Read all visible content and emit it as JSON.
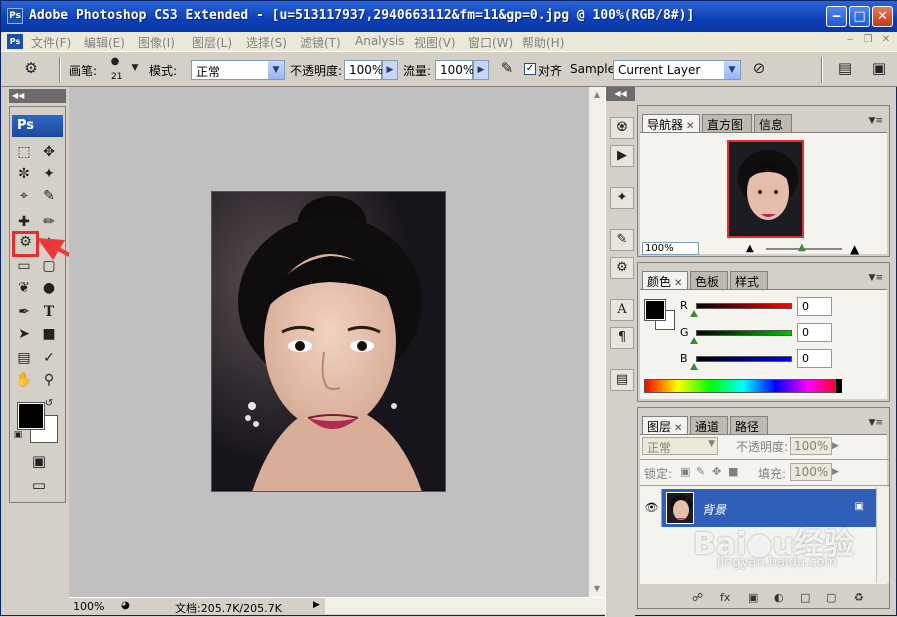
{
  "window": {
    "title": "Adobe Photoshop CS3 Extended - [u=513117937,2940663112&fm=11&gp=0.jpg @ 100%(RGB/8#)]",
    "app_icon": "Ps",
    "minimize": "‒",
    "maximize": "□",
    "close": "✕"
  },
  "menubar": {
    "items": [
      {
        "label": "文件(F)"
      },
      {
        "label": "编辑(E)"
      },
      {
        "label": "图像(I)"
      },
      {
        "label": "图层(L)"
      },
      {
        "label": "选择(S)"
      },
      {
        "label": "滤镜(T)"
      },
      {
        "label": "Analysis"
      },
      {
        "label": "视图(V)"
      },
      {
        "label": "窗口(W)"
      },
      {
        "label": "帮助(H)"
      }
    ]
  },
  "options_bar": {
    "brush_label": "画笔:",
    "brush_size": "21",
    "mode_label": "模式:",
    "mode_value": "正常",
    "opacity_label": "不透明度:",
    "opacity_value": "100%",
    "flow_label": "流量:",
    "flow_value": "100%",
    "aligned_label": "对齐",
    "sample_label": "Sample:",
    "sample_value": "Current Layer"
  },
  "toolbox": {
    "logo": "Ps",
    "selected_tool": "clone-stamp"
  },
  "document": {
    "zoom": "100%",
    "doc_size": "文档:205.7K/205.7K"
  },
  "panels": {
    "navigator": {
      "tabs": [
        "导航器",
        "直方图",
        "信息"
      ],
      "zoom": "100%"
    },
    "color": {
      "tabs": [
        "颜色",
        "色板",
        "样式"
      ],
      "channels": [
        {
          "name": "R",
          "value": "0",
          "color": "#ff0000"
        },
        {
          "name": "G",
          "value": "0",
          "color": "#00c000"
        },
        {
          "name": "B",
          "value": "0",
          "color": "#0000ff"
        }
      ]
    },
    "layers": {
      "tabs": [
        "图层",
        "通道",
        "路径"
      ],
      "blend_mode": "正常",
      "opacity_label": "不透明度:",
      "opacity_value": "100%",
      "lock_label": "锁定:",
      "fill_label": "填充:",
      "fill_value": "100%",
      "layer_name": "背景"
    }
  },
  "watermark": {
    "text": "Bai●u经验",
    "sub": "jingyan.baidu.com"
  },
  "colors": {
    "accent": "#0b3fb8",
    "layer_selected": "#2f5fb8",
    "highlight": "#e03030"
  }
}
